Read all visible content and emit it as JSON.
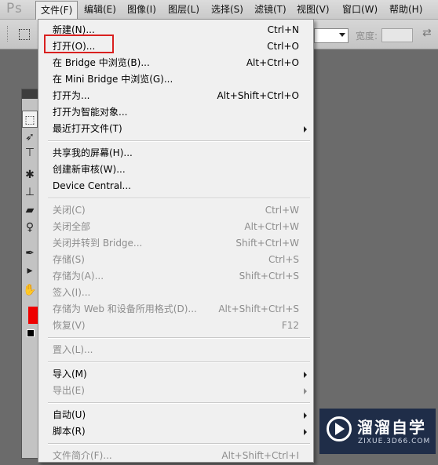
{
  "app": {
    "logo": "Ps"
  },
  "menubar": [
    {
      "label": "文件(F)",
      "active": true
    },
    {
      "label": "编辑(E)"
    },
    {
      "label": "图像(I)"
    },
    {
      "label": "图层(L)"
    },
    {
      "label": "选择(S)"
    },
    {
      "label": "滤镜(T)"
    },
    {
      "label": "视图(V)"
    },
    {
      "label": "窗口(W)"
    },
    {
      "label": "帮助(H)"
    }
  ],
  "options_bar": {
    "width_label": "宽度:"
  },
  "file_menu": {
    "groups": [
      [
        {
          "label": "新建(N)...",
          "shortcut": "Ctrl+N"
        },
        {
          "label": "打开(O)...",
          "shortcut": "Ctrl+O",
          "highlighted": true
        },
        {
          "label": "在 Bridge 中浏览(B)...",
          "shortcut": "Alt+Ctrl+O"
        },
        {
          "label": "在 Mini Bridge 中浏览(G)...",
          "shortcut": ""
        },
        {
          "label": "打开为...",
          "shortcut": "Alt+Shift+Ctrl+O"
        },
        {
          "label": "打开为智能对象...",
          "shortcut": ""
        },
        {
          "label": "最近打开文件(T)",
          "shortcut": "",
          "submenu": true
        }
      ],
      [
        {
          "label": "共享我的屏幕(H)...",
          "shortcut": ""
        },
        {
          "label": "创建新审核(W)...",
          "shortcut": ""
        },
        {
          "label": "Device Central...",
          "shortcut": ""
        }
      ],
      [
        {
          "label": "关闭(C)",
          "shortcut": "Ctrl+W",
          "disabled": true
        },
        {
          "label": "关闭全部",
          "shortcut": "Alt+Ctrl+W",
          "disabled": true
        },
        {
          "label": "关闭并转到 Bridge...",
          "shortcut": "Shift+Ctrl+W",
          "disabled": true
        },
        {
          "label": "存储(S)",
          "shortcut": "Ctrl+S",
          "disabled": true
        },
        {
          "label": "存储为(A)...",
          "shortcut": "Shift+Ctrl+S",
          "disabled": true
        },
        {
          "label": "签入(I)...",
          "shortcut": "",
          "disabled": true
        },
        {
          "label": "存储为 Web 和设备所用格式(D)...",
          "shortcut": "Alt+Shift+Ctrl+S",
          "disabled": true
        },
        {
          "label": "恢复(V)",
          "shortcut": "F12",
          "disabled": true
        }
      ],
      [
        {
          "label": "置入(L)...",
          "shortcut": "",
          "disabled": true
        }
      ],
      [
        {
          "label": "导入(M)",
          "shortcut": "",
          "submenu": true
        },
        {
          "label": "导出(E)",
          "shortcut": "",
          "submenu": true,
          "disabled": true
        }
      ],
      [
        {
          "label": "自动(U)",
          "shortcut": "",
          "submenu": true
        },
        {
          "label": "脚本(R)",
          "shortcut": "",
          "submenu": true
        }
      ],
      [
        {
          "label": "文件简介(F)...",
          "shortcut": "Alt+Shift+Ctrl+I",
          "disabled": true
        }
      ]
    ]
  },
  "watermark": {
    "title": "溜溜自学",
    "subtitle": "ZIXUE.3D66.COM"
  },
  "colors": {
    "highlight_border": "#d9201f",
    "foreground_swatch": "#ef0000",
    "watermark_bg": "#1f2d48"
  }
}
